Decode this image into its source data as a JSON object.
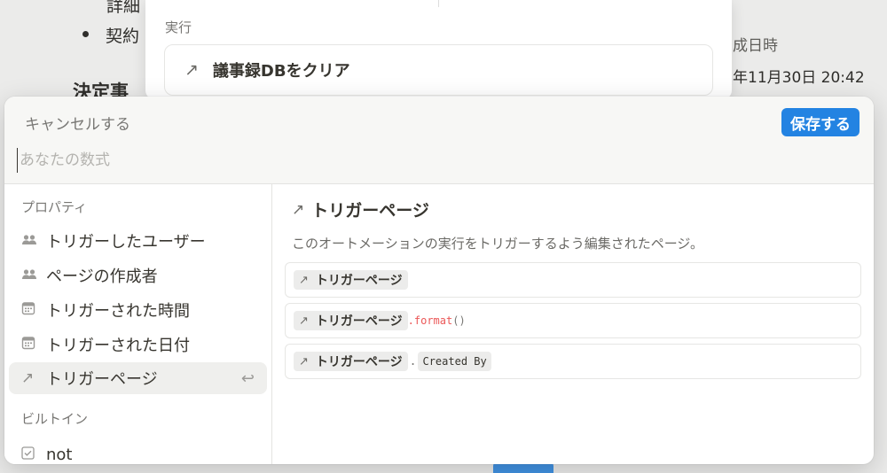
{
  "background": {
    "text_top": "詳細",
    "bullet_text": "契約",
    "heading_partial": "決定事",
    "created_time_label": "成日時",
    "created_time_value": "年11月30日 20:42"
  },
  "exec_menu": {
    "section_label": "実行",
    "clear_db_item": "議事録DBをクリア"
  },
  "editor": {
    "cancel_label": "キャンセルする",
    "save_label": "保存する",
    "formula_placeholder": "あなたの数式",
    "formula_value": ""
  },
  "left_panel": {
    "properties_title": "プロパティ",
    "properties": [
      {
        "label": "トリガーしたユーザー",
        "icon": "people-icon"
      },
      {
        "label": "ページの作成者",
        "icon": "people-icon"
      },
      {
        "label": "トリガーされた時間",
        "icon": "calendar-icon"
      },
      {
        "label": "トリガーされた日付",
        "icon": "calendar-icon"
      },
      {
        "label": "トリガーページ",
        "icon": "relation-arrow-icon"
      }
    ],
    "builtin_title": "ビルトイン",
    "builtins": [
      {
        "label": "not",
        "icon": "checkbox-icon"
      }
    ]
  },
  "detail": {
    "title": "トリガーページ",
    "description": "このオートメーションの実行をトリガーするよう編集されたページ。",
    "example1_chip": "トリガーページ",
    "example2_chip": "トリガーページ",
    "example2_method": ".format",
    "example2_parens": "()",
    "example3_chip": "トリガーページ",
    "example3_dot": ".",
    "example3_prop": "Created By"
  },
  "colors": {
    "accent": "#2383e2",
    "code_red": "#eb5757"
  }
}
